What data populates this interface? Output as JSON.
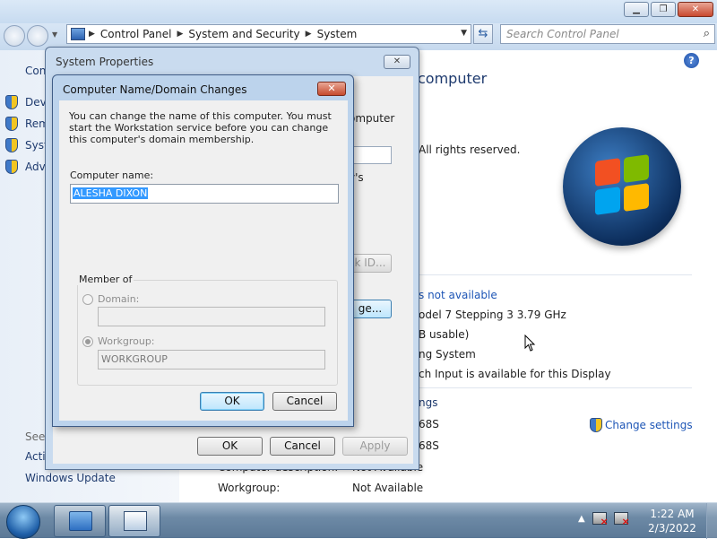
{
  "explorer": {
    "breadcrumb": [
      "Control Panel",
      "System and Security",
      "System"
    ],
    "search_placeholder": "Search Control Panel",
    "left_pane": {
      "title_fragment": "Con",
      "items": [
        "Devi",
        "Rem",
        "Syst",
        "Adv"
      ],
      "see_also": "See",
      "see_also_links": [
        "Acti",
        "Windows Update"
      ]
    },
    "content": {
      "heading_fragment": "computer",
      "rights": "All rights reserved.",
      "not_available_link": "s not available",
      "processor": "odel 7 Stepping 3   3.79 GHz",
      "memory": "B usable)",
      "system_type": "ng System",
      "pen_touch": "ch Input is available for this Display",
      "section_fragment": "ngs",
      "computer_name_frag": "68S",
      "full_name_frag": "68S",
      "change_settings": "Change settings",
      "description_label": "Computer description:",
      "description_value": "Not Available",
      "workgroup_label": "Workgroup:",
      "workgroup_value": "Not Available"
    }
  },
  "system_properties": {
    "title": "System Properties",
    "fragments": {
      "computer": "omputer",
      "ys": "y's",
      "kid": "k ID...",
      "ge": "ge..."
    },
    "ok": "OK",
    "cancel": "Cancel",
    "apply": "Apply"
  },
  "dialog": {
    "title": "Computer Name/Domain Changes",
    "description": "You can change the name of this computer.  You must start the Workstation service before you can change this computer's domain membership.",
    "computer_name_label": "Computer name:",
    "computer_name_value": "ALESHA DIXON",
    "member_of": "Member of",
    "domain_label": "Domain:",
    "domain_value": "",
    "workgroup_label": "Workgroup:",
    "workgroup_value": "WORKGROUP",
    "ok": "OK",
    "cancel": "Cancel"
  },
  "taskbar": {
    "time": "1:22 AM",
    "date": "2/3/2022"
  }
}
